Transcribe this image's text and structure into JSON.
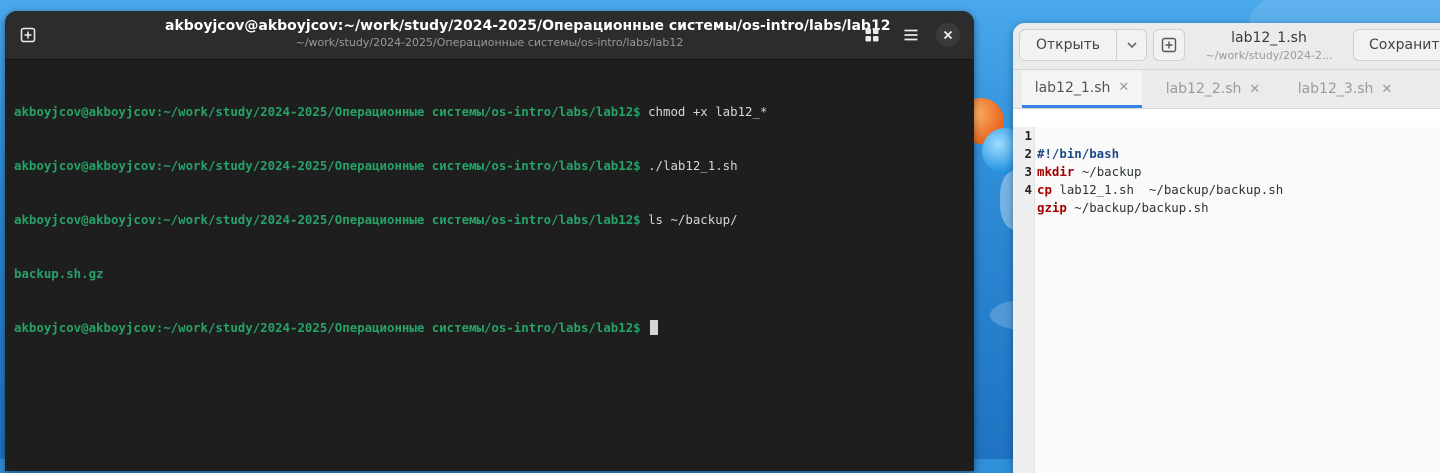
{
  "terminal": {
    "title": "akboyjcov@akboyjcov:~/work/study/2024-2025/Операционные системы/os-intro/labs/lab12",
    "subtitle": "~/work/study/2024-2025/Операционные системы/os-intro/labs/lab12",
    "prompt": "akboyjcov@akboyjcov:~/work/study/2024-2025/Операционные системы/os-intro/labs/lab12$",
    "lines": [
      {
        "command": " chmod +x lab12_*"
      },
      {
        "command": " ./lab12_1.sh"
      },
      {
        "command": " ls ~/backup/"
      },
      {
        "output": "backup.sh.gz"
      },
      {
        "command": " "
      }
    ],
    "icons": {
      "new_tab": "new-tab-icon",
      "tabs": "tab-grid-icon",
      "menu": "hamburger-menu-icon",
      "close": "close-icon"
    }
  },
  "editor": {
    "open_label": "Открыть",
    "title": "lab12_1.sh",
    "subtitle": "~/work/study/2024-2...",
    "save_label": "Сохранить",
    "tabs": [
      {
        "label": "lab12_1.sh",
        "active": true
      },
      {
        "label": "lab12_2.sh",
        "active": false
      },
      {
        "label": "lab12_3.sh",
        "active": false
      }
    ],
    "code": [
      {
        "n": "1",
        "text": "#!/bin/bash"
      },
      {
        "n": "2",
        "kw": "mkdir",
        "rest": " ~/backup"
      },
      {
        "n": "3",
        "kw": "cp",
        "rest": " lab12_1.sh  ~/backup/backup.sh"
      },
      {
        "n": "4",
        "kw": "gzip",
        "rest": " ~/backup/backup.sh"
      }
    ]
  },
  "colors": {
    "prompt_green": "#26a269",
    "keyword_red": "#a40000",
    "shebang_blue": "#204a87",
    "accent": "#3584e4"
  }
}
